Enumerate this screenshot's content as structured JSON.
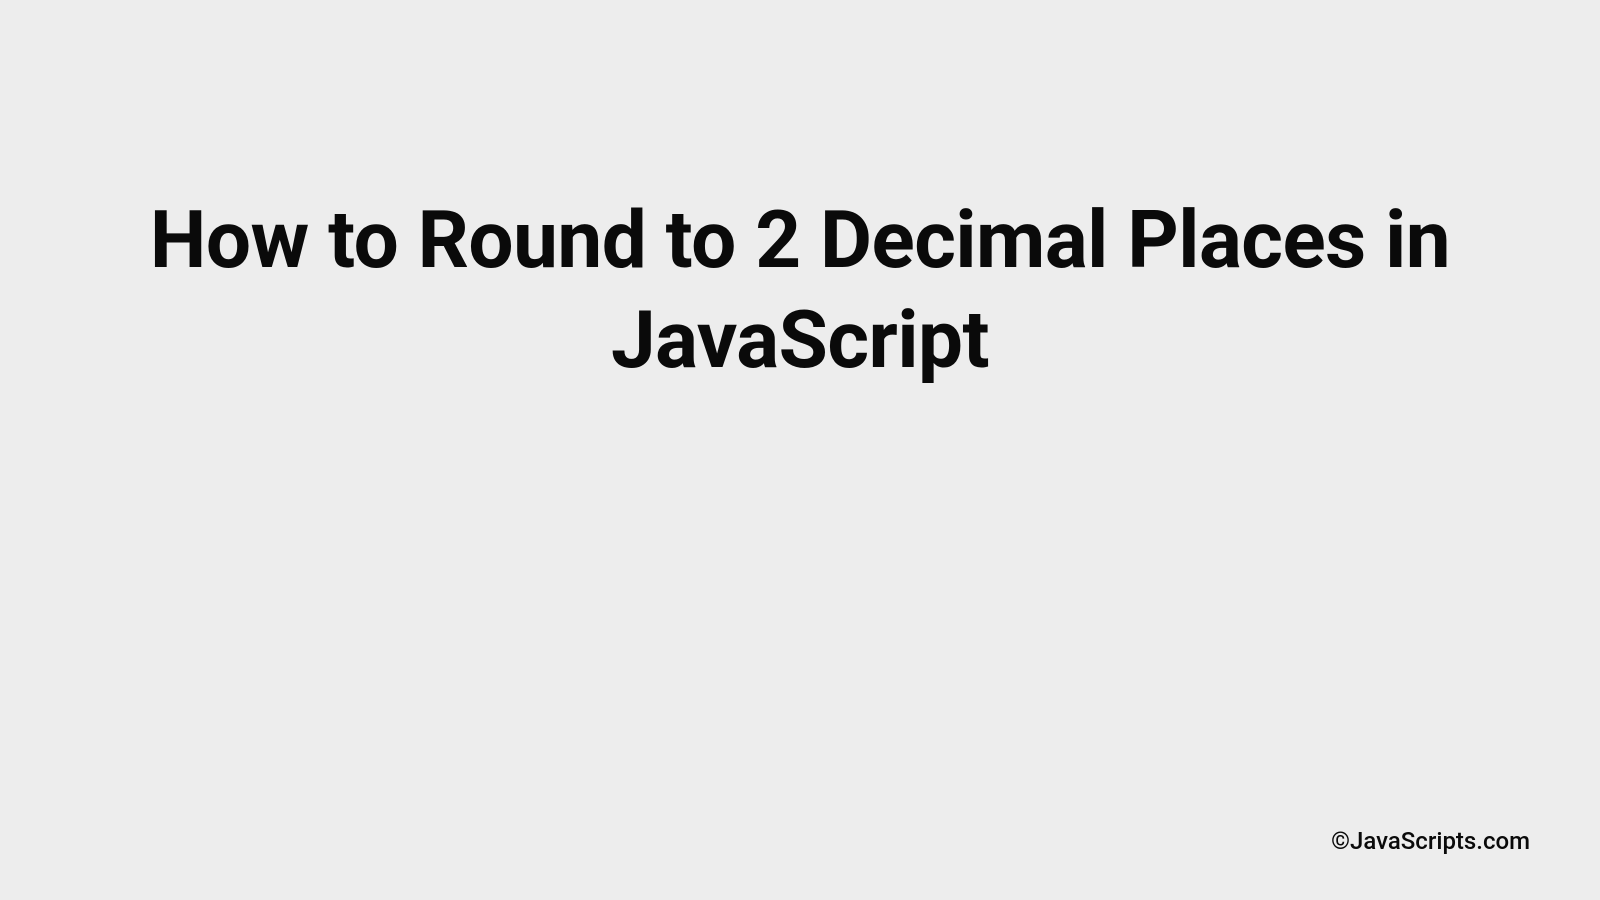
{
  "title": "How to Round to 2 Decimal Places in JavaScript",
  "attribution": "©JavaScripts.com"
}
